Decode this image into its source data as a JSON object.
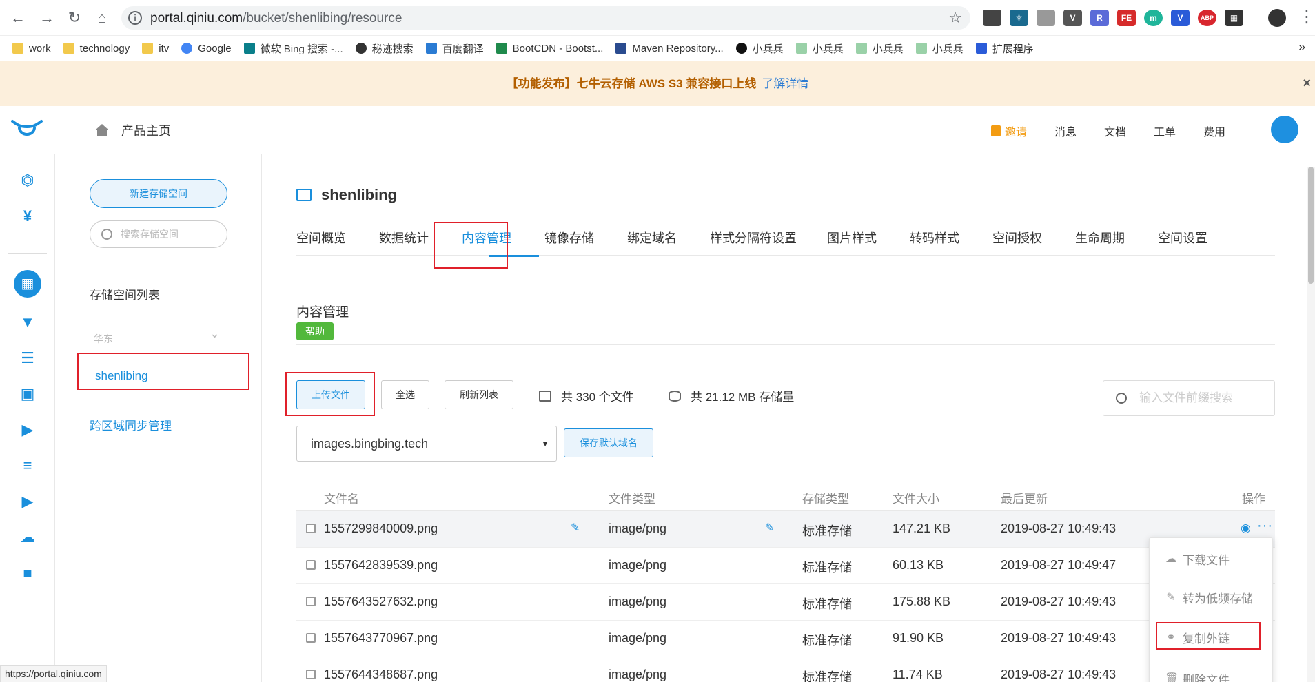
{
  "browser": {
    "url_host": "portal.qiniu.com",
    "url_path": "/bucket/shenlibing/resource",
    "bookmarks": [
      "work",
      "technology",
      "itv",
      "Google",
      "微软 Bing 搜索 -...",
      "秘迹搜索",
      "百度翻译",
      "BootCDN - Bootst...",
      "Maven Repository...",
      "小兵兵",
      "小兵兵",
      "小兵兵",
      "小兵兵",
      "扩展程序"
    ],
    "ext_labels": [
      "FE",
      "ABP"
    ],
    "status_url": "https://portal.qiniu.com"
  },
  "banner": {
    "text": "【功能发布】七牛云存储 AWS S3 兼容接口上线",
    "link": "了解详情",
    "close": "×"
  },
  "header": {
    "home": "产品主页",
    "links": [
      "邀请",
      "消息",
      "文档",
      "工单",
      "费用"
    ]
  },
  "sidebar": {
    "new_bucket": "新建存储空间",
    "search_placeholder": "搜索存储空间",
    "list_title": "存储空间列表",
    "region": "华东",
    "bucket": "shenlibing",
    "cross_sync": "跨区域同步管理"
  },
  "main": {
    "bucket_title": "shenlibing",
    "tabs": [
      "空间概览",
      "数据统计",
      "内容管理",
      "镜像存储",
      "绑定域名",
      "样式分隔符设置",
      "图片样式",
      "转码样式",
      "空间授权",
      "生命周期",
      "空间设置"
    ],
    "active_tab": "内容管理",
    "section_title": "内容管理",
    "help": "帮助",
    "buttons": {
      "upload": "上传文件",
      "select_all": "全选",
      "refresh": "刷新列表",
      "save_domain": "保存默认域名"
    },
    "file_count": "共 330 个文件",
    "storage_total": "共 21.12 MB 存储量",
    "file_search_placeholder": "输入文件前缀搜索",
    "domain": "images.bingbing.tech"
  },
  "table": {
    "headers": [
      "文件名",
      "文件类型",
      "存储类型",
      "文件大小",
      "最后更新",
      "操作"
    ],
    "rows": [
      {
        "name": "1557299840009.png",
        "type": "image/png",
        "storage": "标准存储",
        "size": "147.21 KB",
        "updated": "2019-08-27 10:49:43"
      },
      {
        "name": "1557642839539.png",
        "type": "image/png",
        "storage": "标准存储",
        "size": "60.13 KB",
        "updated": "2019-08-27 10:49:47"
      },
      {
        "name": "1557643527632.png",
        "type": "image/png",
        "storage": "标准存储",
        "size": "175.88 KB",
        "updated": "2019-08-27 10:49:43"
      },
      {
        "name": "1557643770967.png",
        "type": "image/png",
        "storage": "标准存储",
        "size": "91.90 KB",
        "updated": "2019-08-27 10:49:43"
      },
      {
        "name": "1557644348687.png",
        "type": "image/png",
        "storage": "标准存储",
        "size": "11.74 KB",
        "updated": "2019-08-27 10:49:43"
      }
    ]
  },
  "menu": [
    "下载文件",
    "转为低频存储",
    "复制外链",
    "删除文件"
  ],
  "colors": {
    "accent": "#1a8fdc",
    "highlight": "#e0202a",
    "banner_bg": "#fcefdc",
    "help_green": "#52b83c"
  }
}
